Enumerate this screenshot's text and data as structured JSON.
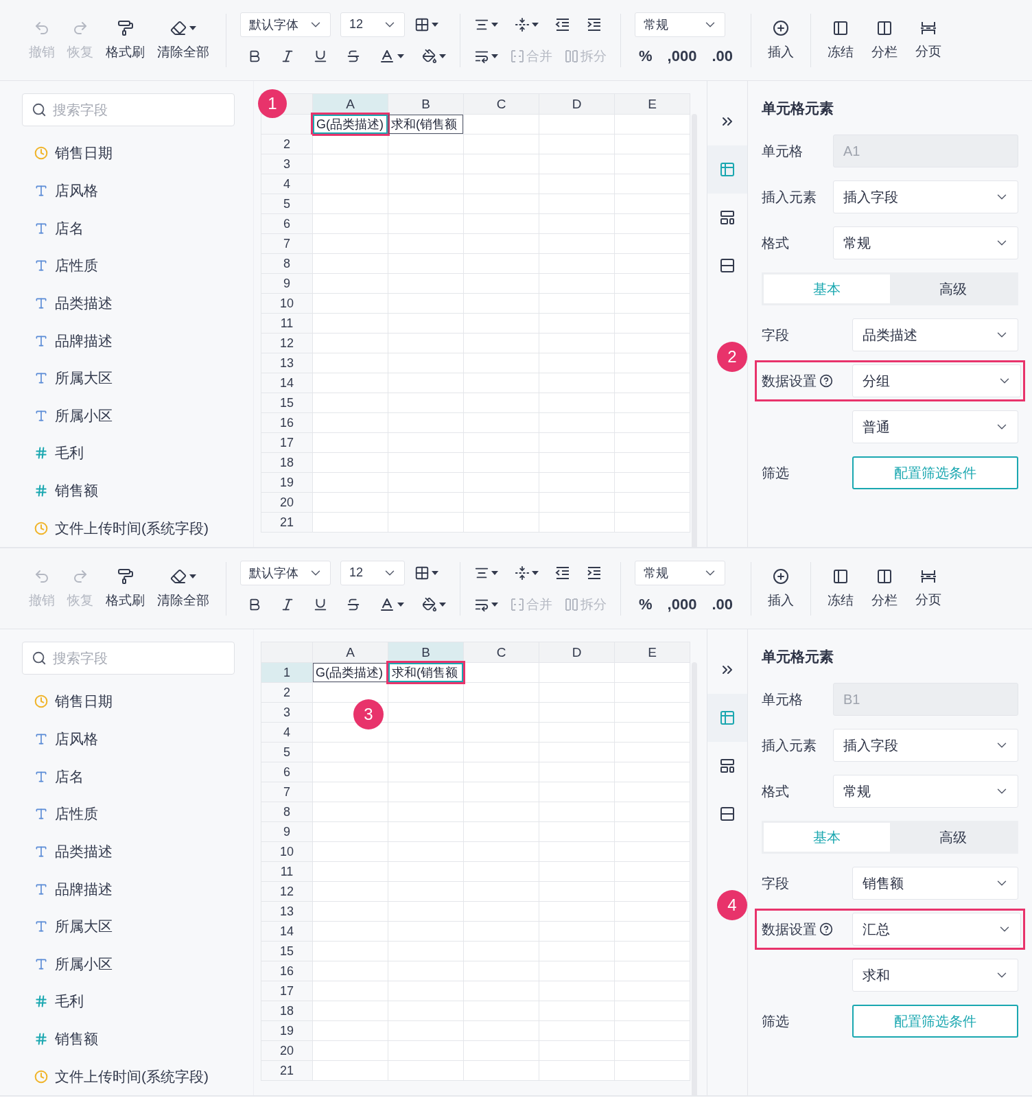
{
  "panels": [
    {
      "toolbar": {
        "history": [
          {
            "kind": "undo",
            "label": "撤销",
            "disabled": true
          },
          {
            "kind": "redo",
            "label": "恢复",
            "disabled": true
          },
          {
            "kind": "brush",
            "label": "格式刷",
            "disabled": false
          },
          {
            "kind": "eraser",
            "label": "清除全部",
            "disabled": false
          }
        ],
        "font": "默认字体",
        "size": "12",
        "merge": [
          {
            "kind": "merge",
            "label": "合并",
            "disabled": true
          },
          {
            "kind": "split",
            "label": "拆分",
            "disabled": true
          }
        ],
        "number_format": "常规",
        "number_buttons": [
          "%",
          ",000",
          ".00"
        ],
        "insert": "插入",
        "layout": [
          {
            "kind": "freeze",
            "label": "冻结"
          },
          {
            "kind": "columns",
            "label": "分栏"
          },
          {
            "kind": "page",
            "label": "分页"
          }
        ]
      },
      "search": {
        "placeholder": "搜索字段"
      },
      "fields": [
        {
          "kind": "date",
          "label": "销售日期"
        },
        {
          "kind": "text",
          "label": "店风格"
        },
        {
          "kind": "text",
          "label": "店名"
        },
        {
          "kind": "text",
          "label": "店性质"
        },
        {
          "kind": "text",
          "label": "品类描述"
        },
        {
          "kind": "text",
          "label": "品牌描述"
        },
        {
          "kind": "text",
          "label": "所属大区"
        },
        {
          "kind": "text",
          "label": "所属小区"
        },
        {
          "kind": "number",
          "label": "毛利"
        },
        {
          "kind": "number",
          "label": "销售额"
        },
        {
          "kind": "date",
          "label": "文件上传时间(系统字段)"
        }
      ],
      "sheet": {
        "columns": [
          {
            "label": "A",
            "selected": true
          },
          {
            "label": "B",
            "selected": false
          },
          {
            "label": "C",
            "selected": false
          },
          {
            "label": "D",
            "selected": false
          },
          {
            "label": "E",
            "selected": false
          }
        ],
        "rows": [
          {
            "marker": "1",
            "cells": [
              {
                "text": "G(品类描述)",
                "selected": true
              },
              {
                "text": "求和(销售额",
                "selected": false
              }
            ]
          },
          {
            "header": "2"
          },
          {
            "header": "3"
          },
          {
            "header": "4"
          },
          {
            "header": "5"
          },
          {
            "header": "6"
          },
          {
            "header": "7"
          },
          {
            "header": "8"
          },
          {
            "header": "9"
          },
          {
            "header": "10"
          },
          {
            "header": "11"
          },
          {
            "header": "12"
          },
          {
            "header": "13"
          },
          {
            "header": "14"
          },
          {
            "header": "15"
          },
          {
            "header": "16"
          },
          {
            "header": "17"
          },
          {
            "header": "18"
          },
          {
            "header": "19"
          },
          {
            "header": "20"
          },
          {
            "header": "21"
          }
        ]
      },
      "props": {
        "title": "单元格元素",
        "cell_label": "单元格",
        "cell_value": "A1",
        "insert_label": "插入元素",
        "insert_value": "插入字段",
        "format_label": "格式",
        "format_value": "常规",
        "tabs": [
          {
            "label": "基本",
            "selected": true
          },
          {
            "label": "高级",
            "selected": false
          }
        ],
        "field_label": "字段",
        "field_value": "品类描述",
        "data_label": "数据设置",
        "data_value": "分组",
        "data_marker": "2",
        "data_sub_value": "普通",
        "filter_label": "筛选",
        "filter_button": "配置筛选条件"
      }
    },
    {
      "toolbar": {
        "history": [
          {
            "kind": "undo",
            "label": "撤销",
            "disabled": true
          },
          {
            "kind": "redo",
            "label": "恢复",
            "disabled": true
          },
          {
            "kind": "brush",
            "label": "格式刷",
            "disabled": false
          },
          {
            "kind": "eraser",
            "label": "清除全部",
            "disabled": false
          }
        ],
        "font": "默认字体",
        "size": "12",
        "merge": [
          {
            "kind": "merge",
            "label": "合并",
            "disabled": true
          },
          {
            "kind": "split",
            "label": "拆分",
            "disabled": true
          }
        ],
        "number_format": "常规",
        "number_buttons": [
          "%",
          ",000",
          ".00"
        ],
        "insert": "插入",
        "layout": [
          {
            "kind": "freeze",
            "label": "冻结"
          },
          {
            "kind": "columns",
            "label": "分栏"
          },
          {
            "kind": "page",
            "label": "分页"
          }
        ]
      },
      "search": {
        "placeholder": "搜索字段"
      },
      "fields": [
        {
          "kind": "date",
          "label": "销售日期"
        },
        {
          "kind": "text",
          "label": "店风格"
        },
        {
          "kind": "text",
          "label": "店名"
        },
        {
          "kind": "text",
          "label": "店性质"
        },
        {
          "kind": "text",
          "label": "品类描述"
        },
        {
          "kind": "text",
          "label": "品牌描述"
        },
        {
          "kind": "text",
          "label": "所属大区"
        },
        {
          "kind": "text",
          "label": "所属小区"
        },
        {
          "kind": "number",
          "label": "毛利"
        },
        {
          "kind": "number",
          "label": "销售额"
        },
        {
          "kind": "date",
          "label": "文件上传时间(系统字段)"
        }
      ],
      "sheet": {
        "marker": "3",
        "columns": [
          {
            "label": "A",
            "selected": false
          },
          {
            "label": "B",
            "selected": true
          },
          {
            "label": "C",
            "selected": false
          },
          {
            "label": "D",
            "selected": false
          },
          {
            "label": "E",
            "selected": false
          }
        ],
        "rows": [
          {
            "header": "1",
            "selected": true,
            "cells": [
              {
                "text": "G(品类描述)",
                "selected": false
              },
              {
                "text": "求和(销售额",
                "selected": true
              }
            ]
          },
          {
            "header": "2"
          },
          {
            "header": "3"
          },
          {
            "header": "4"
          },
          {
            "header": "5"
          },
          {
            "header": "6"
          },
          {
            "header": "7"
          },
          {
            "header": "8"
          },
          {
            "header": "9"
          },
          {
            "header": "10"
          },
          {
            "header": "11"
          },
          {
            "header": "12"
          },
          {
            "header": "13"
          },
          {
            "header": "14"
          },
          {
            "header": "15"
          },
          {
            "header": "16"
          },
          {
            "header": "17"
          },
          {
            "header": "18"
          },
          {
            "header": "19"
          },
          {
            "header": "20"
          },
          {
            "header": "21"
          }
        ]
      },
      "props": {
        "title": "单元格元素",
        "cell_label": "单元格",
        "cell_value": "B1",
        "insert_label": "插入元素",
        "insert_value": "插入字段",
        "format_label": "格式",
        "format_value": "常规",
        "tabs": [
          {
            "label": "基本",
            "selected": true
          },
          {
            "label": "高级",
            "selected": false
          }
        ],
        "field_label": "字段",
        "field_value": "销售额",
        "data_label": "数据设置",
        "data_value": "汇总",
        "data_marker": "4",
        "data_sub_value": "求和",
        "filter_label": "筛选",
        "filter_button": "配置筛选条件"
      }
    }
  ]
}
